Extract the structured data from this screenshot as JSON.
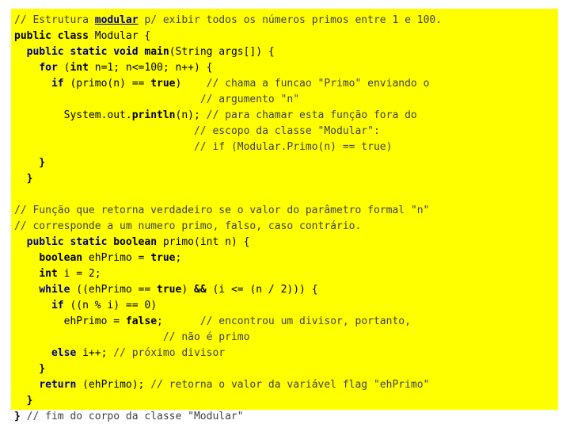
{
  "page": {
    "title": "Java source code slide — Modular prime numbers",
    "background_color": "#ffffff",
    "code_block_color": "#ffff00",
    "comment_color": "#3f3f3f",
    "keyword_blue": "#000080",
    "keyword_black": "#000000"
  },
  "code": {
    "language": "Java",
    "lines": [
      {
        "id": "line-1",
        "tokens": [
          {
            "t": "// Estrutura ",
            "s": "c"
          },
          {
            "t": "modular",
            "s": "ul"
          },
          {
            "t": " p/ exibir todos os números primos entre 1 e 100.",
            "s": "c"
          }
        ]
      },
      {
        "id": "line-2",
        "tokens": [
          {
            "t": "public class",
            "s": "kb"
          },
          {
            "t": " Modular {",
            "s": "p"
          }
        ]
      },
      {
        "id": "line-3",
        "tokens": [
          {
            "t": "  ",
            "s": "p"
          },
          {
            "t": "public static void",
            "s": "kw"
          },
          {
            "t": " ",
            "s": "p"
          },
          {
            "t": "main",
            "s": "kb"
          },
          {
            "t": "(String args[]) {",
            "s": "p"
          }
        ]
      },
      {
        "id": "line-4",
        "tokens": [
          {
            "t": "    ",
            "s": "p"
          },
          {
            "t": "for",
            "s": "kw"
          },
          {
            "t": " (",
            "s": "p"
          },
          {
            "t": "int",
            "s": "kb"
          },
          {
            "t": " n=1; n<=100; n++) {",
            "s": "p"
          }
        ]
      },
      {
        "id": "line-5",
        "tokens": [
          {
            "t": "      ",
            "s": "p"
          },
          {
            "t": "if",
            "s": "kw"
          },
          {
            "t": " (primo(n) == ",
            "s": "p"
          },
          {
            "t": "true",
            "s": "kb"
          },
          {
            "t": ")    ",
            "s": "p"
          },
          {
            "t": "// chama a funcao \"Primo\" enviando o",
            "s": "c"
          }
        ]
      },
      {
        "id": "line-6",
        "tokens": [
          {
            "t": "                              ",
            "s": "p"
          },
          {
            "t": "// argumento \"n\"",
            "s": "c"
          }
        ]
      },
      {
        "id": "line-7",
        "tokens": [
          {
            "t": "        System.out.",
            "s": "p"
          },
          {
            "t": "println",
            "s": "kb"
          },
          {
            "t": "(n); ",
            "s": "p"
          },
          {
            "t": "// para chamar esta função fora do",
            "s": "c"
          }
        ]
      },
      {
        "id": "line-8",
        "tokens": [
          {
            "t": "                             ",
            "s": "p"
          },
          {
            "t": "// escopo da classe \"Modular\":",
            "s": "c"
          }
        ]
      },
      {
        "id": "line-9",
        "tokens": [
          {
            "t": "                             ",
            "s": "p"
          },
          {
            "t": "// if (Modular.Primo(n) == true)",
            "s": "c"
          }
        ]
      },
      {
        "id": "line-10",
        "tokens": [
          {
            "t": "    }",
            "s": "kb"
          }
        ]
      },
      {
        "id": "line-11",
        "tokens": [
          {
            "t": "  }",
            "s": "kb"
          }
        ]
      },
      {
        "id": "line-12",
        "tokens": [
          {
            "t": "",
            "s": "p"
          }
        ]
      },
      {
        "id": "line-13",
        "tokens": [
          {
            "t": "// Função que retorna verdadeiro se o valor do parâmetro formal \"n\"",
            "s": "c"
          }
        ]
      },
      {
        "id": "line-14",
        "tokens": [
          {
            "t": "// corresponde a um numero primo, falso, caso contrário.",
            "s": "c"
          }
        ]
      },
      {
        "id": "line-15",
        "tokens": [
          {
            "t": "  ",
            "s": "p"
          },
          {
            "t": "public static",
            "s": "kw"
          },
          {
            "t": " ",
            "s": "p"
          },
          {
            "t": "boolean",
            "s": "kb"
          },
          {
            "t": " primo(int n) {",
            "s": "p"
          }
        ]
      },
      {
        "id": "line-16",
        "tokens": [
          {
            "t": "    ",
            "s": "p"
          },
          {
            "t": "boolean",
            "s": "kb"
          },
          {
            "t": " ehPrimo = ",
            "s": "p"
          },
          {
            "t": "true",
            "s": "kb"
          },
          {
            "t": ";",
            "s": "p"
          }
        ]
      },
      {
        "id": "line-17",
        "tokens": [
          {
            "t": "    ",
            "s": "p"
          },
          {
            "t": "int",
            "s": "kb"
          },
          {
            "t": " i = 2;",
            "s": "p"
          }
        ]
      },
      {
        "id": "line-18",
        "tokens": [
          {
            "t": "    ",
            "s": "p"
          },
          {
            "t": "while",
            "s": "kw"
          },
          {
            "t": " ((ehPrimo == ",
            "s": "p"
          },
          {
            "t": "true",
            "s": "kb"
          },
          {
            "t": ") ",
            "s": "p"
          },
          {
            "t": "&&",
            "s": "kb"
          },
          {
            "t": " (i <= (n / 2))) {",
            "s": "p"
          }
        ]
      },
      {
        "id": "line-19",
        "tokens": [
          {
            "t": "      ",
            "s": "p"
          },
          {
            "t": "if",
            "s": "kw"
          },
          {
            "t": " ((n % i) == 0)",
            "s": "p"
          }
        ]
      },
      {
        "id": "line-20",
        "tokens": [
          {
            "t": "        ehPrimo = ",
            "s": "p"
          },
          {
            "t": "false",
            "s": "kb"
          },
          {
            "t": ";      ",
            "s": "p"
          },
          {
            "t": "// encontrou um divisor, portanto,",
            "s": "c"
          }
        ]
      },
      {
        "id": "line-21",
        "tokens": [
          {
            "t": "                        ",
            "s": "p"
          },
          {
            "t": "// não é primo",
            "s": "c"
          }
        ]
      },
      {
        "id": "line-22",
        "tokens": [
          {
            "t": "      ",
            "s": "p"
          },
          {
            "t": "else",
            "s": "kw"
          },
          {
            "t": " i++; ",
            "s": "p"
          },
          {
            "t": "// próximo divisor",
            "s": "c"
          }
        ]
      },
      {
        "id": "line-23",
        "tokens": [
          {
            "t": "    }",
            "s": "kb"
          }
        ]
      },
      {
        "id": "line-24",
        "tokens": [
          {
            "t": "    ",
            "s": "p"
          },
          {
            "t": "return",
            "s": "kw"
          },
          {
            "t": " (ehPrimo); ",
            "s": "p"
          },
          {
            "t": "// retorna o valor da variável flag \"ehPrimo\"",
            "s": "c"
          }
        ]
      },
      {
        "id": "line-25",
        "tokens": [
          {
            "t": "  }",
            "s": "kb"
          }
        ]
      },
      {
        "id": "line-26",
        "tokens": [
          {
            "t": "}",
            "s": "kb"
          },
          {
            "t": " // fim do corpo da classe \"Modular\"",
            "s": "c"
          }
        ]
      }
    ]
  }
}
